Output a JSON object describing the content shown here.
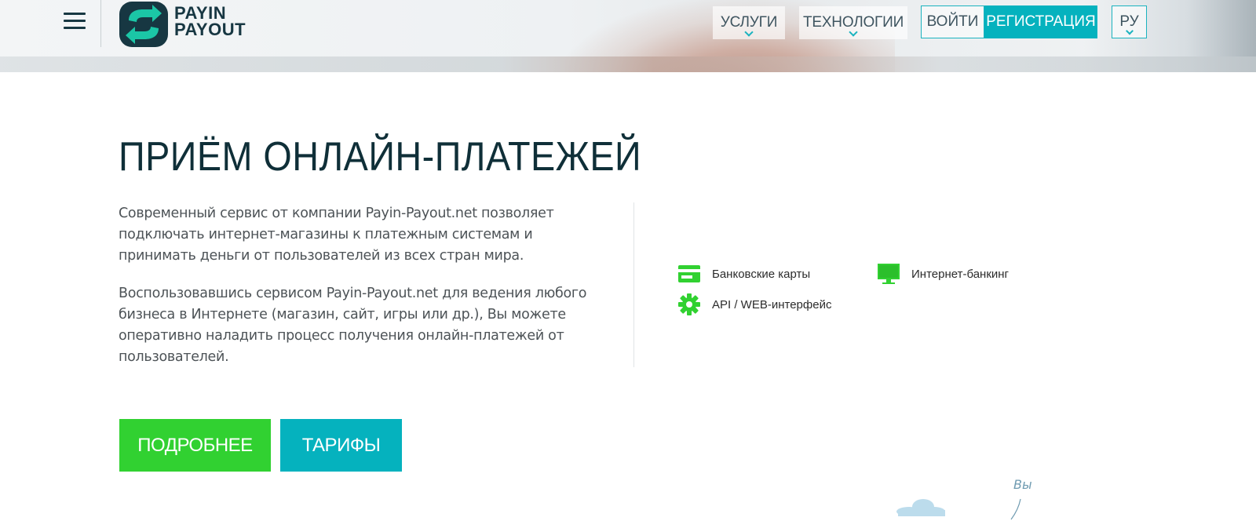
{
  "header": {
    "logo_line1": "PAYIN",
    "logo_line2": "PAYOUT",
    "logo_icon": "arrows-exchange-icon",
    "menu_icon": "hamburger-menu-icon",
    "nav": {
      "services": "УСЛУГИ",
      "technologies": "ТЕХНОЛОГИИ"
    },
    "login": "ВОЙТИ",
    "register": "РЕГИСТРАЦИЯ",
    "language": "РУ"
  },
  "main": {
    "title": "ПРИЁМ ОНЛАЙН-ПЛАТЕЖЕЙ",
    "paragraph1": "Современный сервис от компании Payin-Payout.net позволяет подключать интернет-магазины к платежным системам и принимать деньги от пользователей из всех стран мира.",
    "paragraph2": "Воспользовавшись сервисом Payin-Payout.net для ведения любого бизнеса в Интернете (магазин, сайт, игры или др.), Вы можете оперативно наладить процесс получения онлайн-платежей от пользователей.",
    "features": [
      {
        "label": "Банковские карты",
        "icon": "credit-card-icon"
      },
      {
        "label": "Интернет-банкинг",
        "icon": "monitor-icon"
      },
      {
        "label": "API / WEB-интерфейс",
        "icon": "gear-icon"
      }
    ],
    "buttons": {
      "more": "ПОДРОБНЕЕ",
      "tariffs": "ТАРИФЫ"
    },
    "illustration_label": "Вы"
  },
  "colors": {
    "brand_dark": "#0f2f38",
    "accent_teal": "#05b2be",
    "accent_green": "#31d131",
    "text_body": "#4d5357"
  }
}
